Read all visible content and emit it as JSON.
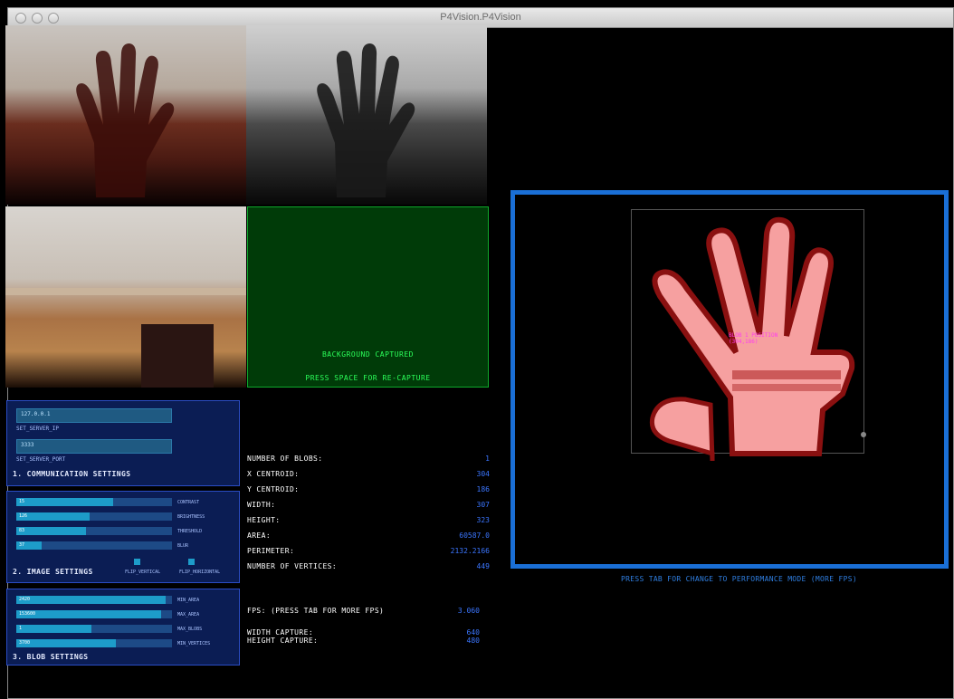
{
  "window": {
    "title": "P4Vision.P4Vision"
  },
  "status": {
    "line1": "BACKGROUND CAPTURED",
    "line2": "PRESS SPACE FOR RE-CAPTURE"
  },
  "blob": {
    "label_top": "BLOB 1 POSITION",
    "label_bottom": "(304,186)"
  },
  "footer": {
    "hint": "PRESS TAB FOR CHANGE TO PERFORMANCE MODE (MORE FPS)"
  },
  "communication": {
    "title": "1. COMMUNICATION SETTINGS",
    "fields": [
      {
        "value": "127.0.0.1",
        "caption": "SET_SERVER_IP"
      },
      {
        "value": "3333",
        "caption": "SET_SERVER_PORT"
      }
    ]
  },
  "image": {
    "title": "2. IMAGE SETTINGS",
    "sliders": [
      {
        "value": "15",
        "caption": "CONTRAST",
        "level": 0.62
      },
      {
        "value": "126",
        "caption": "BRIGHTNESS",
        "level": 0.47
      },
      {
        "value": "83",
        "caption": "THRESHOLD",
        "level": 0.45
      },
      {
        "value": "37",
        "caption": "BLUR",
        "level": 0.16
      }
    ],
    "toggles": [
      "FLIP_VERTICAL",
      "FLIP_HORIZONTAL"
    ]
  },
  "blobs": {
    "title": "3. BLOB SETTINGS",
    "sliders": [
      {
        "value": "2420",
        "caption": "MIN_AREA",
        "level": 0.96
      },
      {
        "value": "153600",
        "caption": "MAX_AREA",
        "level": 0.93
      },
      {
        "value": "1",
        "caption": "MAX_BLOBS",
        "level": 0.48
      },
      {
        "value": "3700",
        "caption": "MIN_VERTICES",
        "level": 0.64
      }
    ]
  },
  "stats": [
    {
      "label": "NUMBER OF BLOBS:",
      "value": "1"
    },
    {
      "label": "X CENTROID:",
      "value": "304"
    },
    {
      "label": "Y CENTROID:",
      "value": "186"
    },
    {
      "label": "WIDTH:",
      "value": "307"
    },
    {
      "label": "HEIGHT:",
      "value": "323"
    },
    {
      "label": "AREA:",
      "value": "60587.0"
    },
    {
      "label": "PERIMETER:",
      "value": "2132.2166"
    },
    {
      "label": "NUMBER OF VERTICES:",
      "value": "449"
    }
  ],
  "fps": {
    "label": "FPS: (PRESS TAB FOR MORE FPS)",
    "value": "3.060"
  },
  "capture": {
    "width_label": "WIDTH CAPTURE:",
    "width_value": "640",
    "height_label": "HEIGHT CAPTURE:",
    "height_value": "480"
  },
  "colors": {
    "accent_blue": "#1a6fd6",
    "panel_bg": "#0b1d54",
    "status_green": "#2bff5a"
  }
}
